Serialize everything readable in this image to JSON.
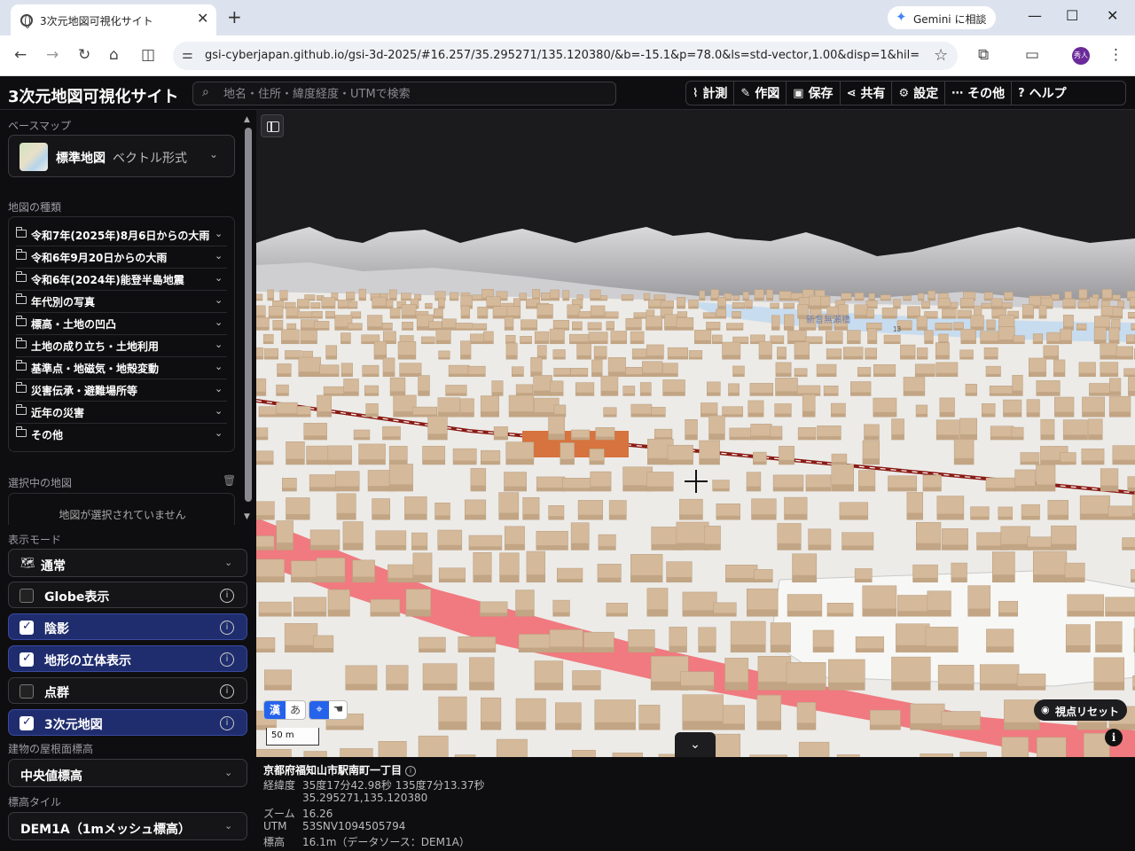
{
  "browser": {
    "tab_title": "3次元地図可視化サイト",
    "gemini_label": "Gemini に相談",
    "url": "gsi-cyberjapan.github.io/gsi-3d-2025/#16.257/35.295271/135.120380/&b=-15.1&p=78.0&ls=std-vector,1.00&disp=1&hil=1&ter...",
    "avatar_text": "秀人"
  },
  "header": {
    "title": "3次元地図可視化サイト",
    "search_placeholder": "地名・住所・緯度経度・UTMで検索",
    "menu": [
      {
        "label": "計測",
        "icon": "ruler-icon",
        "glyph": "⌇"
      },
      {
        "label": "作図",
        "icon": "pencil-icon",
        "glyph": "✎"
      },
      {
        "label": "保存",
        "icon": "save-icon",
        "glyph": "▣"
      },
      {
        "label": "共有",
        "icon": "share-icon",
        "glyph": "⋖"
      },
      {
        "label": "設定",
        "icon": "gear-icon",
        "glyph": "⚙"
      },
      {
        "label": "その他",
        "icon": "more-icon",
        "glyph": "⋯"
      },
      {
        "label": "ヘルプ",
        "icon": "help-icon",
        "glyph": "?"
      }
    ]
  },
  "sidebar": {
    "basemap_section": "ベースマップ",
    "basemap_name": "標準地図",
    "basemap_format": "ベクトル形式",
    "maptypes_section": "地図の種類",
    "maptypes": [
      "令和7年(2025年)8月6日からの大雨",
      "令和6年9月20日からの大雨",
      "令和6年(2024年)能登半島地震",
      "年代別の写真",
      "標高・土地の凹凸",
      "土地の成り立ち・土地利用",
      "基準点・地磁気・地殻変動",
      "災害伝承・避難場所等",
      "近年の災害",
      "その他"
    ],
    "selected_section": "選択中の地図",
    "selected_empty": "地図が選択されていません",
    "display_mode_section": "表示モード",
    "display_mode": "通常",
    "toggles": [
      {
        "label": "Globe表示",
        "checked": false
      },
      {
        "label": "陰影",
        "checked": true
      },
      {
        "label": "地形の立体表示",
        "checked": true
      },
      {
        "label": "点群",
        "checked": false
      },
      {
        "label": "3次元地図",
        "checked": true
      }
    ],
    "roof_section": "建物の屋根面標高",
    "roof_value": "中央値標高",
    "elev_tile_section": "標高タイル",
    "elev_tile_value": "DEM1A（1mメッシュ標高）"
  },
  "map": {
    "lang_kanji": "漢",
    "lang_hira": "あ",
    "scale": "50 m",
    "reset_label": "視点リセット",
    "labels": [
      "新音無瀬橋",
      "13"
    ],
    "colors": {
      "building": "#d4b99a",
      "road_red": "#f07a7f",
      "rail": "#8a1a14",
      "sky": "#1b1b1d",
      "mountain": "#b9b9bb"
    }
  },
  "info": {
    "address": "京都府福知山市駅南町一丁目",
    "latlon_label": "経緯度",
    "latlon_dms": "35度17分42.98秒 135度7分13.37秒",
    "latlon_dec": "35.295271,135.120380",
    "zoom_label": "ズーム",
    "zoom": "16.26",
    "utm_label": "UTM",
    "utm": "53SNV1094505794",
    "elev_label": "標高",
    "elev": "16.1m（データソース：DEM1A）"
  }
}
